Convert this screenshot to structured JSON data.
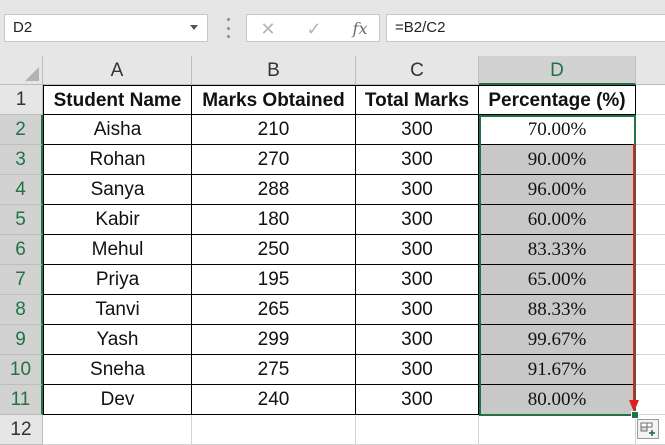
{
  "formula_bar": {
    "name_box": "D2",
    "cancel_icon": "✕",
    "enter_icon": "✓",
    "fx_label": "fx",
    "formula": "=B2/C2"
  },
  "grid": {
    "column_headers": [
      "A",
      "B",
      "C",
      "D"
    ],
    "row_headers": [
      "1",
      "2",
      "3",
      "4",
      "5",
      "6",
      "7",
      "8",
      "9",
      "10",
      "11",
      "12"
    ],
    "active_cell": "D2",
    "selected_range": "D2:D11"
  },
  "table": {
    "headers": [
      "Student Name",
      "Marks Obtained",
      "Total Marks",
      "Percentage (%)"
    ],
    "rows": [
      {
        "name": "Aisha",
        "marks": "210",
        "total": "300",
        "pct": "70.00%"
      },
      {
        "name": "Rohan",
        "marks": "270",
        "total": "300",
        "pct": "90.00%"
      },
      {
        "name": "Sanya",
        "marks": "288",
        "total": "300",
        "pct": "96.00%"
      },
      {
        "name": "Kabir",
        "marks": "180",
        "total": "300",
        "pct": "60.00%"
      },
      {
        "name": "Mehul",
        "marks": "250",
        "total": "300",
        "pct": "83.33%"
      },
      {
        "name": "Priya",
        "marks": "195",
        "total": "300",
        "pct": "65.00%"
      },
      {
        "name": "Tanvi",
        "marks": "265",
        "total": "300",
        "pct": "88.33%"
      },
      {
        "name": "Yash",
        "marks": "299",
        "total": "300",
        "pct": "99.67%"
      },
      {
        "name": "Sneha",
        "marks": "275",
        "total": "300",
        "pct": "91.67%"
      },
      {
        "name": "Dev",
        "marks": "240",
        "total": "300",
        "pct": "80.00%"
      }
    ]
  },
  "colors": {
    "excel_green": "#217346",
    "fill_arrow": "#e02020",
    "selection_fill": "#c8c8c8"
  }
}
